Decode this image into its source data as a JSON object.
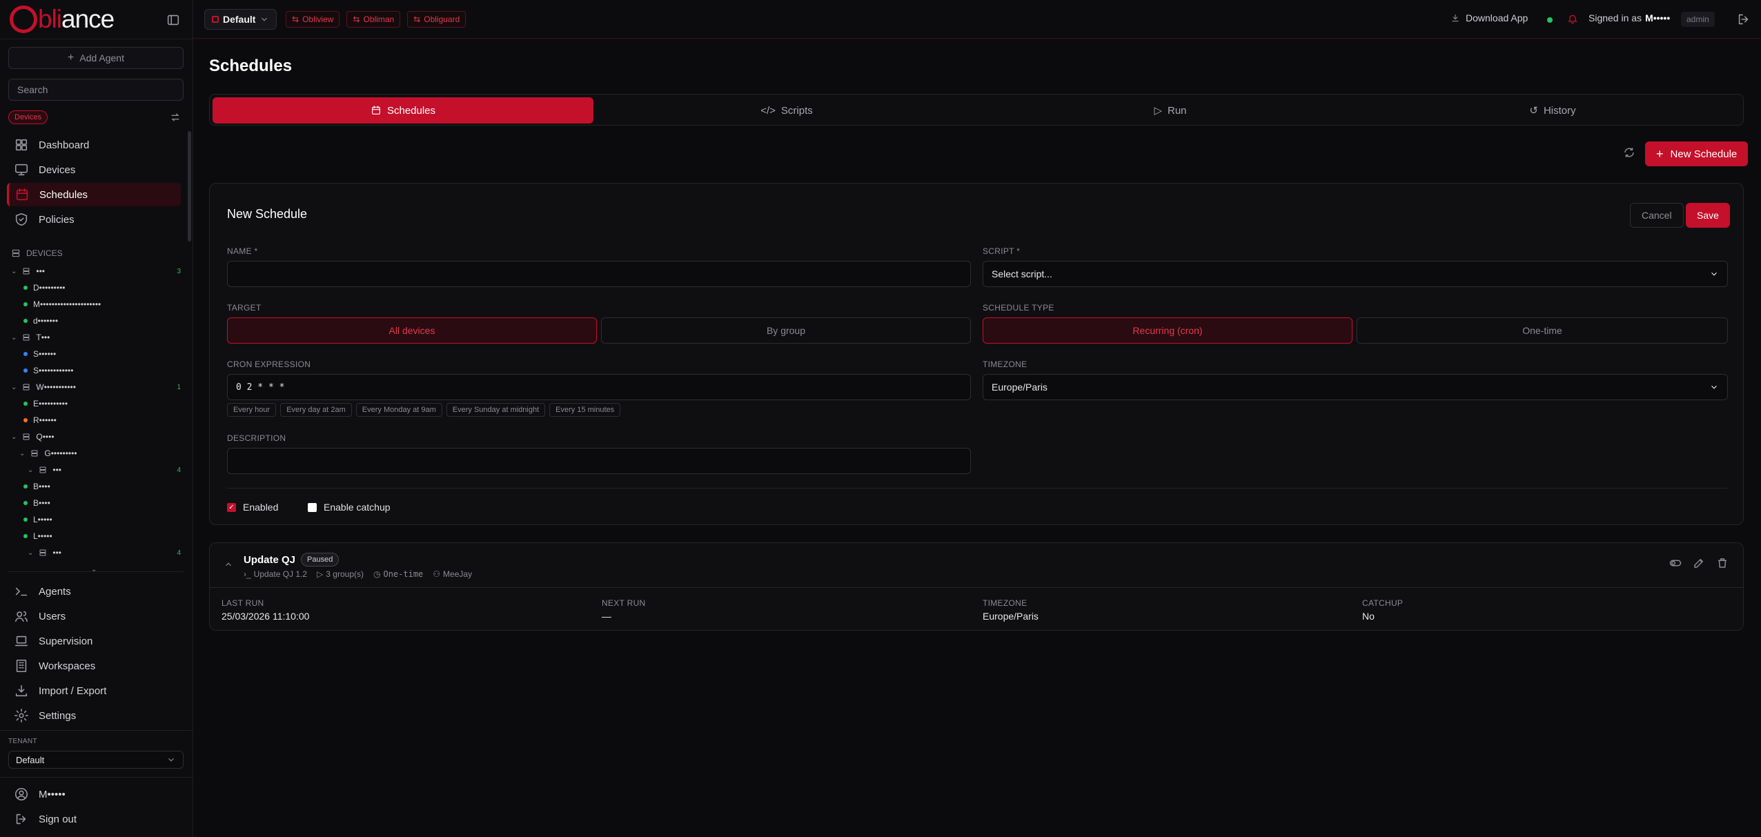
{
  "brand": {
    "logo_text_pre": "O",
    "logo_text_mid": "bli",
    "logo_text_post": "ance"
  },
  "sidebar": {
    "add_agent": "Add Agent",
    "search_placeholder": "Search",
    "devices_badge": "Devices",
    "nav": [
      {
        "label": "Dashboard",
        "icon": "grid-icon"
      },
      {
        "label": "Devices",
        "icon": "monitor-icon"
      },
      {
        "label": "Schedules",
        "icon": "calendar-icon"
      },
      {
        "label": "Policies",
        "icon": "shield-icon"
      }
    ],
    "devices_heading": "DEVICES",
    "tree": [
      {
        "label": "•••",
        "type": "group",
        "count": "3"
      },
      {
        "label": "D•••••••••",
        "type": "device",
        "color": "#22c55e"
      },
      {
        "label": "M•••••••••••••••••••••",
        "type": "device",
        "color": "#22c55e"
      },
      {
        "label": "d•••••••",
        "type": "device",
        "color": "#22c55e"
      },
      {
        "label": "T•••",
        "type": "group",
        "count": ""
      },
      {
        "label": "S••••••",
        "type": "device",
        "color": "#3b82f6"
      },
      {
        "label": "S••••••••••••",
        "type": "device",
        "color": "#3b82f6"
      },
      {
        "label": "W•••••••••••",
        "type": "group",
        "count": "1"
      },
      {
        "label": "E••••••••••",
        "type": "device",
        "color": "#22c55e"
      },
      {
        "label": "R••••••",
        "type": "device",
        "color": "#f97316"
      },
      {
        "label": "Q••••",
        "type": "group",
        "count": ""
      },
      {
        "label": "G•••••••••",
        "type": "subgroup",
        "count": ""
      },
      {
        "label": "•••",
        "type": "subsubgroup",
        "count": "4"
      },
      {
        "label": "B••••",
        "type": "device",
        "color": "#22c55e"
      },
      {
        "label": "B••••",
        "type": "device",
        "color": "#22c55e"
      },
      {
        "label": "L•••••",
        "type": "device",
        "color": "#22c55e"
      },
      {
        "label": "L•••••",
        "type": "device",
        "color": "#22c55e"
      },
      {
        "label": "•••",
        "type": "subsubgroup",
        "count": "4"
      }
    ],
    "bottom_nav": [
      {
        "label": "Agents",
        "icon": "terminal-icon"
      },
      {
        "label": "Users",
        "icon": "users-icon"
      },
      {
        "label": "Supervision",
        "icon": "laptop-icon"
      },
      {
        "label": "Workspaces",
        "icon": "building-icon"
      },
      {
        "label": "Import / Export",
        "icon": "import-icon"
      },
      {
        "label": "Settings",
        "icon": "gear-icon"
      }
    ],
    "tenant_label": "TENANT",
    "tenant_value": "Default",
    "user_name": "M•••••",
    "sign_out": "Sign out"
  },
  "topbar": {
    "workspace": "Default",
    "apps": [
      "Obliview",
      "Obliman",
      "Obliguard"
    ],
    "download": "Download App",
    "signed_in_prefix": "Signed in as",
    "signed_in_user": "M•••••",
    "role": "admin"
  },
  "page": {
    "title": "Schedules",
    "tabs": [
      {
        "label": "Schedules",
        "icon": "calendar-icon"
      },
      {
        "label": "Scripts",
        "icon": "code-icon"
      },
      {
        "label": "Run",
        "icon": "play-icon"
      },
      {
        "label": "History",
        "icon": "history-icon"
      }
    ],
    "new_schedule_button": "New Schedule"
  },
  "form": {
    "title": "New Schedule",
    "cancel": "Cancel",
    "save": "Save",
    "name_label": "NAME *",
    "name_value": "",
    "script_label": "SCRIPT *",
    "script_value": "Select script...",
    "target_label": "TARGET",
    "target_options": [
      "All devices",
      "By group"
    ],
    "schedule_type_label": "SCHEDULE TYPE",
    "schedule_type_options": [
      "Recurring (cron)",
      "One-time"
    ],
    "cron_label": "CRON EXPRESSION",
    "cron_value": "0 2 * * *",
    "cron_presets": [
      "Every hour",
      "Every day at 2am",
      "Every Monday at 9am",
      "Every Sunday at midnight",
      "Every 15 minutes"
    ],
    "timezone_label": "TIMEZONE",
    "timezone_value": "Europe/Paris",
    "description_label": "DESCRIPTION",
    "description_value": "",
    "enabled_label": "Enabled",
    "enabled": true,
    "catchup_label": "Enable catchup",
    "catchup": false
  },
  "schedule": {
    "name": "Update QJ",
    "status": "Paused",
    "script": "Update QJ 1.2",
    "groups": "3 group(s)",
    "type": "One-time",
    "owner": "MeeJay",
    "last_run_label": "LAST RUN",
    "last_run": "25/03/2026 11:10:00",
    "next_run_label": "NEXT RUN",
    "next_run": "—",
    "timezone_label": "TIMEZONE",
    "timezone": "Europe/Paris",
    "catchup_label": "CATCHUP",
    "catchup": "No"
  },
  "colors": {
    "accent": "#c4102a",
    "bg": "#0b0b0d",
    "success": "#22c55e"
  }
}
